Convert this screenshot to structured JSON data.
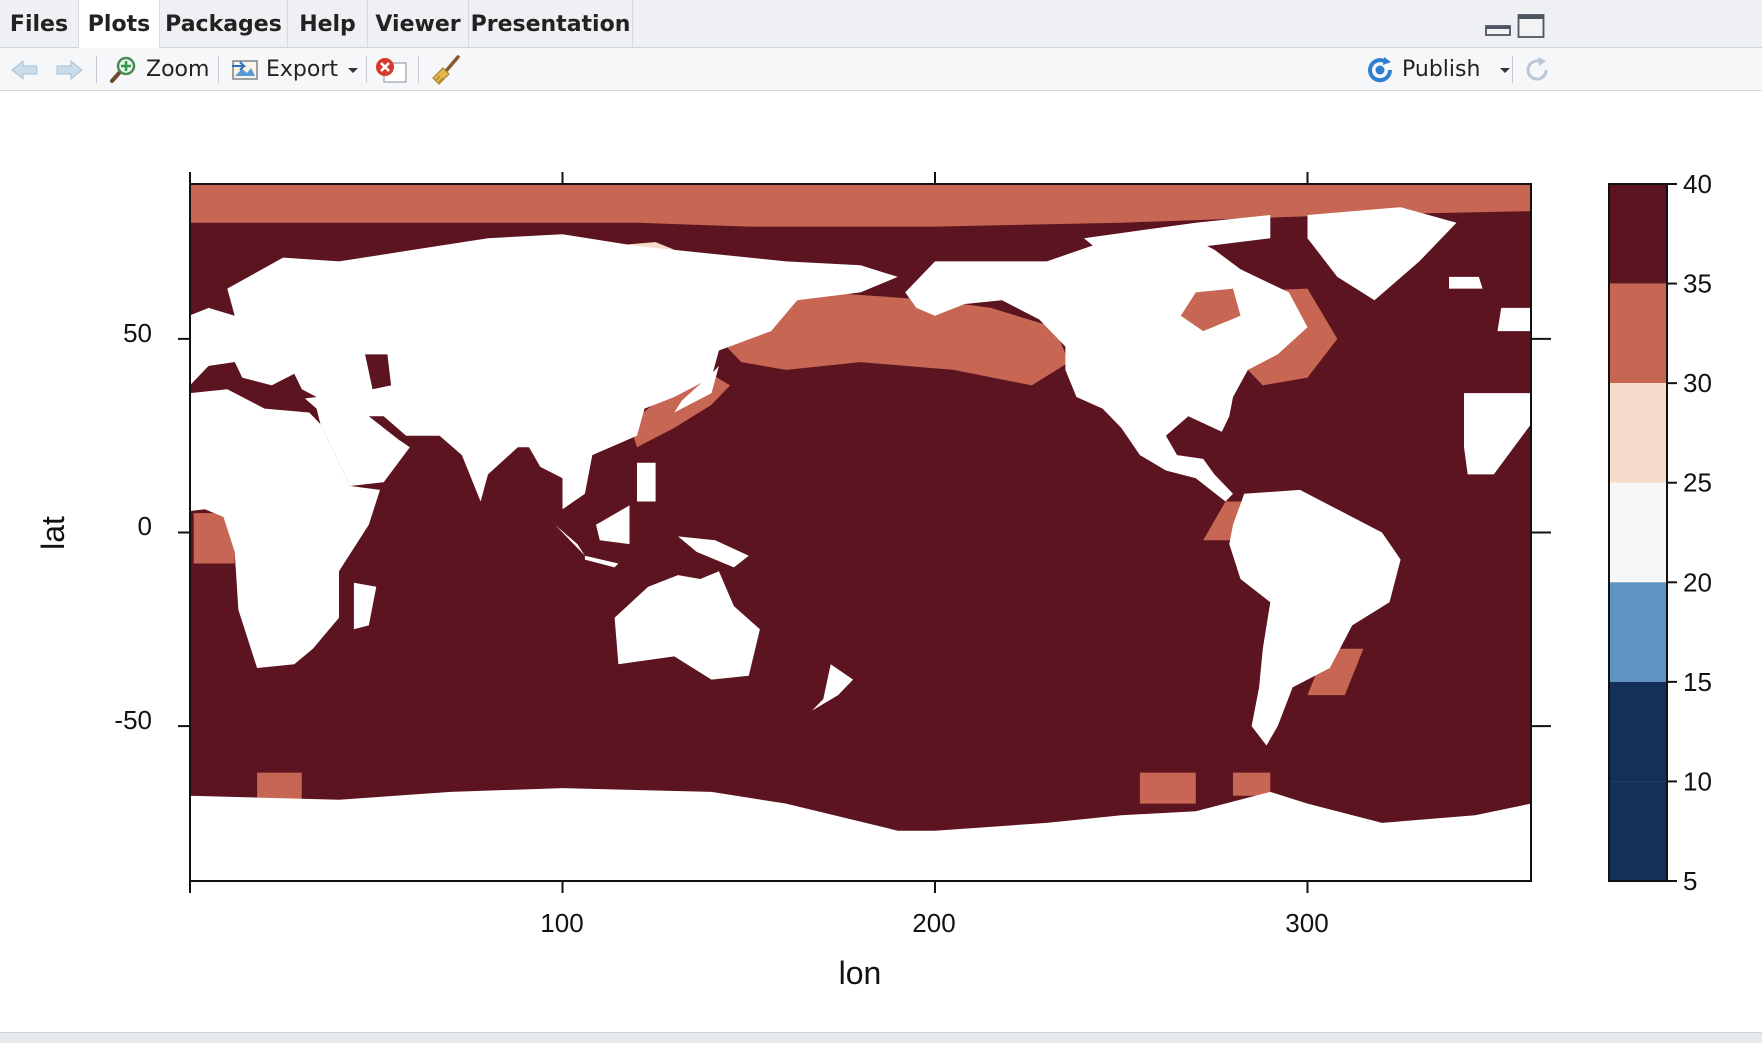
{
  "tabs": [
    {
      "label": "Files"
    },
    {
      "label": "Plots"
    },
    {
      "label": "Packages"
    },
    {
      "label": "Help"
    },
    {
      "label": "Viewer"
    },
    {
      "label": "Presentation"
    }
  ],
  "toolbar": {
    "zoom_label": "Zoom",
    "export_label": "Export",
    "publish_label": "Publish"
  },
  "icons": [
    "back-arrow-icon",
    "forward-arrow-icon",
    "zoom-magnifier-icon",
    "export-image-icon",
    "remove-plot-icon",
    "broom-clear-icon",
    "publish-icon",
    "refresh-icon",
    "minimize-icon",
    "maximize-icon"
  ],
  "chart_data": {
    "type": "heatmap",
    "title": "",
    "xlabel": "lon",
    "ylabel": "lat",
    "xlim": [
      0,
      360
    ],
    "ylim": [
      -90,
      90
    ],
    "x_ticks": [
      "100",
      "200",
      "300"
    ],
    "y_ticks": [
      "50",
      "0",
      "-50"
    ],
    "colorbar": {
      "breaks": [
        5,
        10,
        15,
        20,
        25,
        30,
        35,
        40
      ],
      "tick_labels": [
        "40",
        "35",
        "30",
        "25",
        "20",
        "15",
        "10",
        "5"
      ],
      "bins": [
        {
          "range": [
            35,
            40
          ],
          "color": "#5c1420"
        },
        {
          "range": [
            30,
            35
          ],
          "color": "#c76652"
        },
        {
          "range": [
            25,
            30
          ],
          "color": "#f5dccb"
        },
        {
          "range": [
            20,
            25
          ],
          "color": "#f7f7f7"
        },
        {
          "range": [
            15,
            20
          ],
          "color": "#5e94c2"
        },
        {
          "range": [
            10,
            15
          ],
          "color": "#14305a"
        }
      ]
    },
    "colors": {
      "ocean_high": "#5c1420",
      "ocean_mid": "#c76652",
      "ocean_low": "#f5dccb",
      "cold": "#5e94c2",
      "very_cold": "#14305a",
      "land_missing": "#ffffff"
    }
  }
}
